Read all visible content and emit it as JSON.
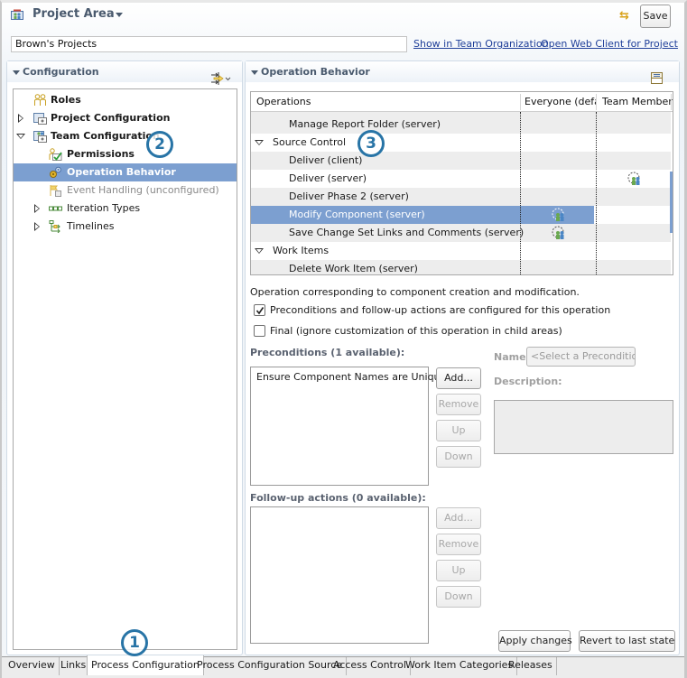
{
  "header": {
    "title": "Project Area",
    "project_name": "Brown's Projects",
    "save_label": "Save",
    "links": [
      "Show in Team Organization",
      "Open Web Client for Project"
    ]
  },
  "configuration": {
    "title": "Configuration",
    "tree": [
      {
        "label": "Roles",
        "icon": "roles-icon",
        "bold": true,
        "expander": "none",
        "level": 1
      },
      {
        "label": "Project Configuration",
        "icon": "project-configuration-icon",
        "bold": true,
        "expander": "closed",
        "level": 1
      },
      {
        "label": "Team Configuration",
        "icon": "team-configuration-icon",
        "bold": true,
        "expander": "open",
        "level": 1
      },
      {
        "label": "Permissions",
        "icon": "permissions-icon",
        "bold": true,
        "expander": "none",
        "level": 2
      },
      {
        "label": "Operation Behavior",
        "icon": "operation-behavior-icon",
        "bold": true,
        "expander": "none",
        "level": 2,
        "selected": true
      },
      {
        "label": "Event Handling (unconfigured)",
        "icon": "event-handling-icon",
        "bold": false,
        "dim": true,
        "expander": "none",
        "level": 2
      },
      {
        "label": "Iteration Types",
        "icon": "iteration-types-icon",
        "bold": false,
        "expander": "closed",
        "level": 1
      },
      {
        "label": "Timelines",
        "icon": "timelines-icon",
        "bold": false,
        "expander": "closed",
        "level": 1
      }
    ]
  },
  "operation_behavior": {
    "title": "Operation Behavior",
    "columns": [
      "Operations",
      "Everyone (defa",
      "Team Member"
    ],
    "rows": [
      {
        "label": "Manage Report Folder (server)",
        "indent": 2,
        "everyone": false,
        "team_member": false
      },
      {
        "label": "Source Control",
        "indent": 1,
        "group": true,
        "everyone": false,
        "team_member": false
      },
      {
        "label": "Deliver (client)",
        "indent": 2,
        "everyone": false,
        "team_member": false
      },
      {
        "label": "Deliver (server)",
        "indent": 2,
        "everyone": false,
        "team_member": true
      },
      {
        "label": "Deliver Phase 2 (server)",
        "indent": 2,
        "everyone": false,
        "team_member": false
      },
      {
        "label": "Modify Component (server)",
        "indent": 2,
        "selected": true,
        "everyone": true,
        "team_member": false
      },
      {
        "label": "Save Change Set Links and Comments (server)",
        "indent": 2,
        "everyone": true,
        "team_member": false
      },
      {
        "label": "Work Items",
        "indent": 1,
        "group": true,
        "everyone": false,
        "team_member": false
      },
      {
        "label": "Delete Work Item (server)",
        "indent": 2,
        "everyone": false,
        "team_member": false
      }
    ],
    "description": "Operation corresponding to component creation and modification.",
    "checkbox_configured": {
      "label": "Preconditions and follow-up actions are configured for this operation",
      "checked": true
    },
    "checkbox_final": {
      "label": "Final (ignore customization of this operation in child areas)",
      "checked": false
    },
    "preconditions": {
      "title": "Preconditions (1 available):",
      "items": [
        "Ensure Component Names are Unique"
      ],
      "buttons": [
        "Add...",
        "Remove",
        "Up",
        "Down"
      ]
    },
    "followups": {
      "title": "Follow-up actions (0 available):",
      "items": [],
      "buttons": [
        "Add...",
        "Remove",
        "Up",
        "Down"
      ]
    },
    "name_label": "Name:",
    "name_placeholder": "<Select a Precondition o",
    "description_label": "Description:",
    "apply_label": "Apply changes",
    "revert_label": "Revert to last  state"
  },
  "tabs": [
    "Overview",
    "Links",
    "Process Configuration",
    "Process Configuration Source",
    "Access Control",
    "Work Item Categories",
    "Releases"
  ],
  "active_tab": "Process Configuration",
  "callouts": [
    "1",
    "2",
    "3"
  ],
  "colors": {
    "selection": "#7c9fd0",
    "callout": "#2874a6",
    "link": "#1f3f99",
    "header_text": "#4a5a6e"
  }
}
